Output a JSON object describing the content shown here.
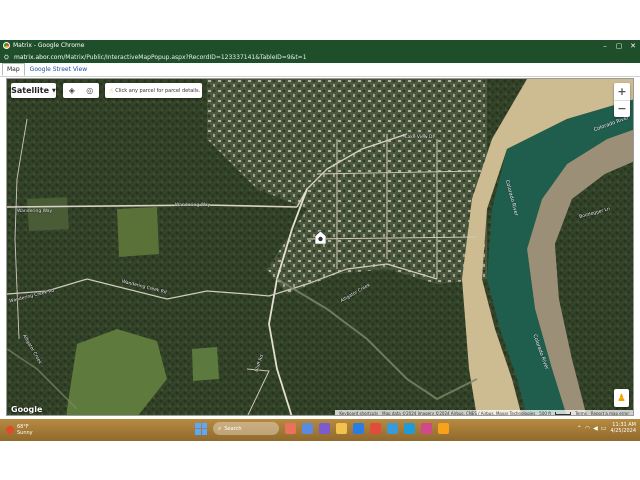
{
  "window": {
    "title": "Matrix - Google Chrome",
    "controls": {
      "minimize": "–",
      "maximize": "▢",
      "close": "✕"
    }
  },
  "address": {
    "host": "matrix.abor.com",
    "path": "/Matrix/Public/InteractiveMapPopup.aspx?RecordID=123337141&TableID=9&t=1"
  },
  "tabs": [
    {
      "label": "Map",
      "active": true
    },
    {
      "label": "Google Street View",
      "active": false
    }
  ],
  "map": {
    "type_label": "Satellite",
    "hint": "Click any parcel for parcel details.",
    "zoom_in": "+",
    "zoom_out": "−",
    "logo": "Google",
    "attribution": {
      "shortcuts": "Keyboard shortcuts",
      "data": "Map data ©2024 Imagery ©2024 Airbus, CNES / Airbus, Maxar Technologies",
      "scale": "500 ft",
      "terms": "Terms",
      "report": "Report a map error"
    },
    "road_labels": [
      "Wandering Way",
      "Wandering Way",
      "Lake View Dr",
      "Wandering Creek Rd",
      "Wandering Creek Rd",
      "Alligator Creek",
      "Alligator Creek",
      "Bluff Rd",
      "Colorado River",
      "Colorado River",
      "Colorado River",
      "Bootlegger Ln"
    ],
    "colors": {
      "river": "#1f5e4d",
      "sand": "#cdbb92",
      "forest": "#2f3d24",
      "field": "#5e7a3c"
    }
  },
  "taskbar": {
    "weather_temp": "68°F",
    "weather_desc": "Sunny",
    "search_placeholder": "Search",
    "time": "11:31 AM",
    "date": "4/25/2024"
  }
}
